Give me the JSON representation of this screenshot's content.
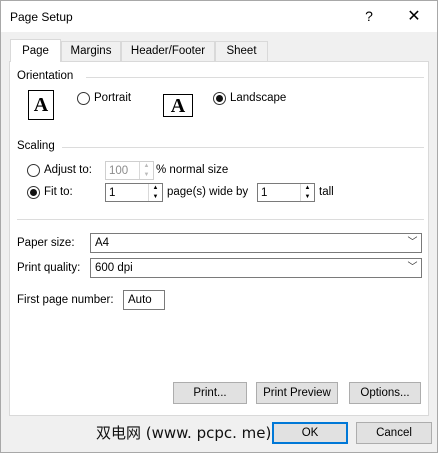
{
  "window": {
    "title": "Page Setup",
    "help_symbol": "?",
    "close_symbol": "✕"
  },
  "tabs": [
    {
      "label": "Page",
      "active": true
    },
    {
      "label": "Margins",
      "active": false
    },
    {
      "label": "Header/Footer",
      "active": false
    },
    {
      "label": "Sheet",
      "active": false
    }
  ],
  "orientation": {
    "group_label": "Orientation",
    "portrait_label": "Portrait",
    "landscape_label": "Landscape",
    "selected": "landscape",
    "icon_letter": "A"
  },
  "scaling": {
    "group_label": "Scaling",
    "adjust_to_label": "Adjust to:",
    "adjust_to_value": "100",
    "adjust_to_suffix": "% normal size",
    "fit_to_label": "Fit to:",
    "fit_wide_value": "1",
    "fit_wide_suffix": "page(s) wide by",
    "fit_tall_value": "1",
    "fit_tall_suffix": "tall",
    "selected": "fit_to"
  },
  "paper": {
    "paper_size_label": "Paper size:",
    "paper_size_value": "A4",
    "print_quality_label": "Print quality:",
    "print_quality_value": "600 dpi",
    "first_page_label": "First page number:",
    "first_page_value": "Auto"
  },
  "buttons": {
    "print": "Print...",
    "print_preview": "Print Preview",
    "options": "Options...",
    "ok": "OK",
    "cancel": "Cancel"
  },
  "watermark": "双电网 (www. pcpc. me)",
  "colors": {
    "accent": "#0078d7",
    "panel_bg": "#ffffff",
    "dialog_bg": "#f0f0f0"
  }
}
